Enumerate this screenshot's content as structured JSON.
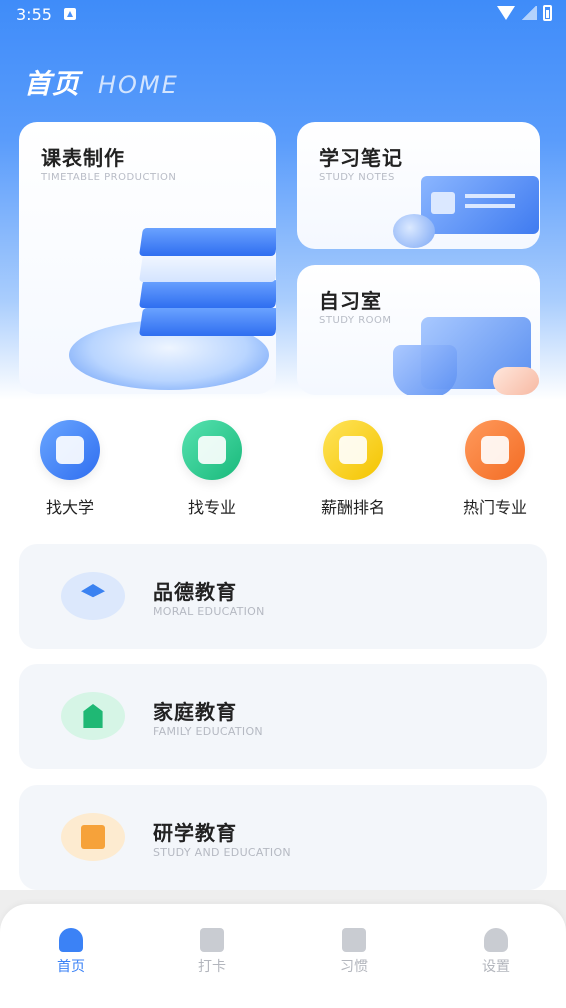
{
  "status_bar": {
    "time": "3:55"
  },
  "header": {
    "title_cn": "首页",
    "title_en": "HOME"
  },
  "cards": [
    {
      "title": "课表制作",
      "subtitle": "TIMETABLE PRODUCTION"
    },
    {
      "title": "学习笔记",
      "subtitle": "STUDY NOTES"
    },
    {
      "title": "自习室",
      "subtitle": "STUDY ROOM"
    }
  ],
  "quick_links": [
    {
      "label": "找大学",
      "icon": "university-icon"
    },
    {
      "label": "找专业",
      "icon": "major-icon"
    },
    {
      "label": "薪酬排名",
      "icon": "salary-rank-icon"
    },
    {
      "label": "热门专业",
      "icon": "hot-major-icon"
    }
  ],
  "education": [
    {
      "title": "品德教育",
      "subtitle": "MORAL EDUCATION",
      "icon": "graduate-icon"
    },
    {
      "title": "家庭教育",
      "subtitle": "FAMILY EDUCATION",
      "icon": "house-icon"
    },
    {
      "title": "研学教育",
      "subtitle": "STUDY AND EDUCATION",
      "icon": "book-icon"
    }
  ],
  "bottom_nav": [
    {
      "label": "首页",
      "icon": "home-icon",
      "active": true
    },
    {
      "label": "打卡",
      "icon": "checkin-icon",
      "active": false
    },
    {
      "label": "习惯",
      "icon": "habit-icon",
      "active": false
    },
    {
      "label": "设置",
      "icon": "settings-user-icon",
      "active": false
    }
  ],
  "colors": {
    "primary": "#3b82f6",
    "hero_top": "#3f8cf9",
    "card_bg": "#f3f6fa"
  }
}
